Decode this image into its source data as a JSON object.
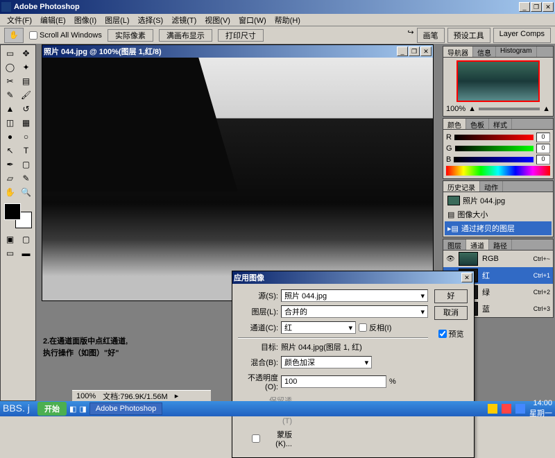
{
  "app": {
    "title": "Adobe Photoshop"
  },
  "menu": [
    "文件(F)",
    "编辑(E)",
    "图像(I)",
    "图层(L)",
    "选择(S)",
    "滤镜(T)",
    "视图(V)",
    "窗口(W)",
    "帮助(H)"
  ],
  "optbar": {
    "scroll_all": "Scroll All Windows",
    "btn1": "实际像素",
    "btn2": "满画布显示",
    "btn3": "打印尺寸",
    "right": [
      "画笔",
      "预设工具",
      "Layer Comps"
    ]
  },
  "document": {
    "title": "照片 044.jpg @ 100%(图层 1,红/8)"
  },
  "dialog": {
    "title": "应用图像",
    "source_label": "源(S):",
    "source_value": "照片 044.jpg",
    "layer_label": "图层(L):",
    "layer_value": "合并的",
    "channel_label": "通道(C):",
    "channel_value": "红",
    "invert_label": "反相(I)",
    "target_label": "目标:",
    "target_value": "照片 044.jpg(图层 1, 红)",
    "blend_label": "混合(B):",
    "blend_value": "颜色加深",
    "opacity_label": "不透明度(O):",
    "opacity_value": "100",
    "opacity_unit": "%",
    "preserve_label": "保留透明区域(T)",
    "mask_label": "蒙版(K)...",
    "ok": "好",
    "cancel": "取消",
    "preview": "预览"
  },
  "panels": {
    "nav": {
      "tabs": [
        "导航器",
        "信息",
        "Histogram"
      ],
      "zoom": "100%"
    },
    "color": {
      "tabs": [
        "颜色",
        "色板",
        "样式"
      ],
      "r": "0",
      "g": "0",
      "b": "0"
    },
    "history": {
      "tabs": [
        "历史记录",
        "动作"
      ],
      "items": [
        {
          "label": "照片 044.jpg"
        },
        {
          "label": "图像大小"
        },
        {
          "label": "通过拷贝的图层",
          "selected": true
        }
      ]
    },
    "channels": {
      "tabs": [
        "图层",
        "通道",
        "路径"
      ],
      "items": [
        {
          "name": "RGB",
          "key": "Ctrl+~",
          "eye": true
        },
        {
          "name": "红",
          "key": "Ctrl+1",
          "eye": true,
          "selected": true
        },
        {
          "name": "绿",
          "key": "Ctrl+2"
        },
        {
          "name": "蓝",
          "key": "Ctrl+3"
        }
      ]
    }
  },
  "annotation": {
    "line1": "2.在通道面版中点红通道,",
    "line2": "执行操作（如图）\"好\""
  },
  "status": {
    "zoom": "100%",
    "docsize": "文档:796.9K/1.56M"
  },
  "taskbar": {
    "start": "开始",
    "app": "Adobe Photoshop",
    "time": "14:00",
    "day": "星期一",
    "bbs": "BBS. j"
  }
}
